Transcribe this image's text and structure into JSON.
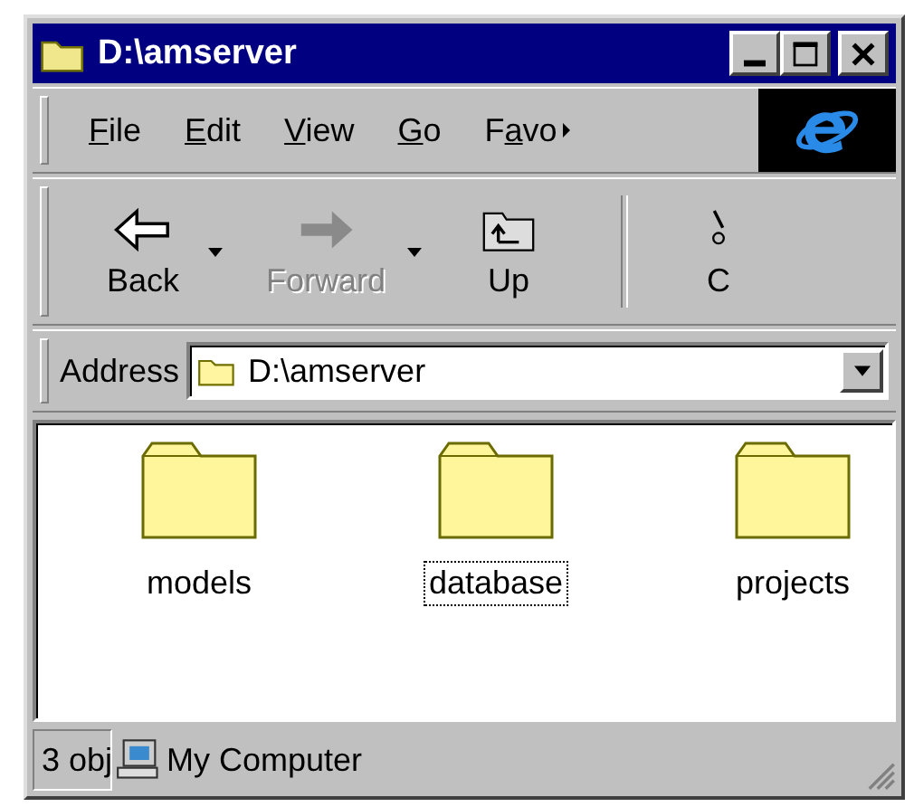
{
  "window": {
    "title": "D:\\amserver"
  },
  "menu": [
    {
      "key": "F",
      "after": "ile"
    },
    {
      "key": "E",
      "after": "dit"
    },
    {
      "key": "V",
      "after": "iew"
    },
    {
      "key": "G",
      "after": "o"
    },
    {
      "before": "F",
      "key": "a",
      "after": "vo"
    }
  ],
  "toolbar": [
    {
      "kind": "back",
      "label": "Back",
      "disabled": false,
      "dropdown": true
    },
    {
      "kind": "forward",
      "label": "Forward",
      "disabled": true,
      "dropdown": true
    },
    {
      "kind": "up",
      "label": "Up",
      "disabled": false,
      "dropdown": false
    },
    {
      "kind": "cut",
      "label": "C",
      "disabled": false,
      "dropdown": false
    }
  ],
  "address": {
    "label": "Address",
    "value": "D:\\amserver"
  },
  "items": [
    {
      "name": "models",
      "focused": false
    },
    {
      "name": "database",
      "focused": true
    },
    {
      "name": "projects",
      "focused": false
    }
  ],
  "status_bar": {
    "count": "3 obj",
    "location": "My Computer"
  }
}
